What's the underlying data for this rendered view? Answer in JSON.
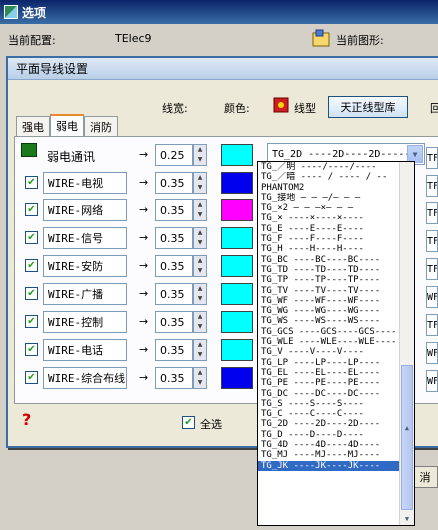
{
  "window": {
    "title": "选项"
  },
  "outer": {
    "current_config_label": "当前配置:",
    "current_config_value": "TElec9",
    "current_shape_label": "当前图形:",
    "bottom_button_label": "消"
  },
  "dialog": {
    "title": "平面导线设置",
    "headers": {
      "width": "线宽:",
      "color": "颜色:",
      "linetype": "线型",
      "library_button": "天正线型库",
      "back": "回"
    },
    "tabs": [
      {
        "label": "强电",
        "active": false
      },
      {
        "label": "弱电",
        "active": true
      },
      {
        "label": "消防",
        "active": false
      }
    ],
    "rows": [
      {
        "name": "弱电通讯",
        "checkbox": false,
        "width": "0.25",
        "color": "#00ffff",
        "linetype": "TG_2D ----2D----2D-----",
        "stub": "TF"
      },
      {
        "name": "WIRE-电视",
        "checkbox": true,
        "width": "0.35",
        "color": "#0000ee",
        "linetype": "",
        "stub": "TF"
      },
      {
        "name": "WIRE-网络",
        "checkbox": true,
        "width": "0.35",
        "color": "#ff00ff",
        "linetype": "",
        "stub": "TF"
      },
      {
        "name": "WIRE-信号",
        "checkbox": true,
        "width": "0.35",
        "color": "#00ffff",
        "linetype": "",
        "stub": "TF"
      },
      {
        "name": "WIRE-安防",
        "checkbox": true,
        "width": "0.35",
        "color": "#00ffff",
        "linetype": "",
        "stub": "TF"
      },
      {
        "name": "WIRE-广播",
        "checkbox": true,
        "width": "0.35",
        "color": "#00ffff",
        "linetype": "",
        "stub": "WF"
      },
      {
        "name": "WIRE-控制",
        "checkbox": true,
        "width": "0.35",
        "color": "#00ffff",
        "linetype": "",
        "stub": "TF"
      },
      {
        "name": "WIRE-电话",
        "checkbox": true,
        "width": "0.35",
        "color": "#00ffff",
        "linetype": "",
        "stub": "WF"
      },
      {
        "name": "WIRE-综合布线",
        "checkbox": true,
        "width": "0.35",
        "color": "#0000ee",
        "linetype": "",
        "stub": "WF"
      }
    ],
    "select_all_label": "全选",
    "select_all_checked": true,
    "arrow_glyph": "→"
  },
  "dropdown": {
    "items": [
      "TG_／明 ----/----/----",
      "TG_／暗 ---- / ---- / --",
      "PHANTOM2",
      "TG_接地 — — —/— — —",
      "TG_×2 — — —×— — —",
      "TG_× ----×----×----",
      "TG_E ----E----E----",
      "TG_F ----F----F----",
      "TG_H ----H----H----",
      "TG_BC ----BC----BC----",
      "TG_TD ----TD----TD----",
      "TG_TP ----TP----TP----",
      "TG_TV ----TV----TV----",
      "TG_WF ----WF----WF----",
      "TG_WG ----WG----WG----",
      "TG_WS ----WS----WS----",
      "TG_GCS ----GCS----GCS----",
      "TG_WLE ----WLE----WLE----",
      "TG_V ----V----V----",
      "TG_LP ----LP----LP----",
      "TG_EL ----EL----EL----",
      "TG_PE ----PE----PE----",
      "TG_DC ----DC----DC----",
      "TG_S ----S----S----",
      "TG_C ----C----C----",
      "TG_2D ----2D----2D----",
      "TG_D ----D----D----",
      "TG_4D ----4D----4D----",
      "TG_MJ ----MJ----MJ----",
      "TG_JK ----JK----JK----"
    ],
    "selected_index": 29
  }
}
